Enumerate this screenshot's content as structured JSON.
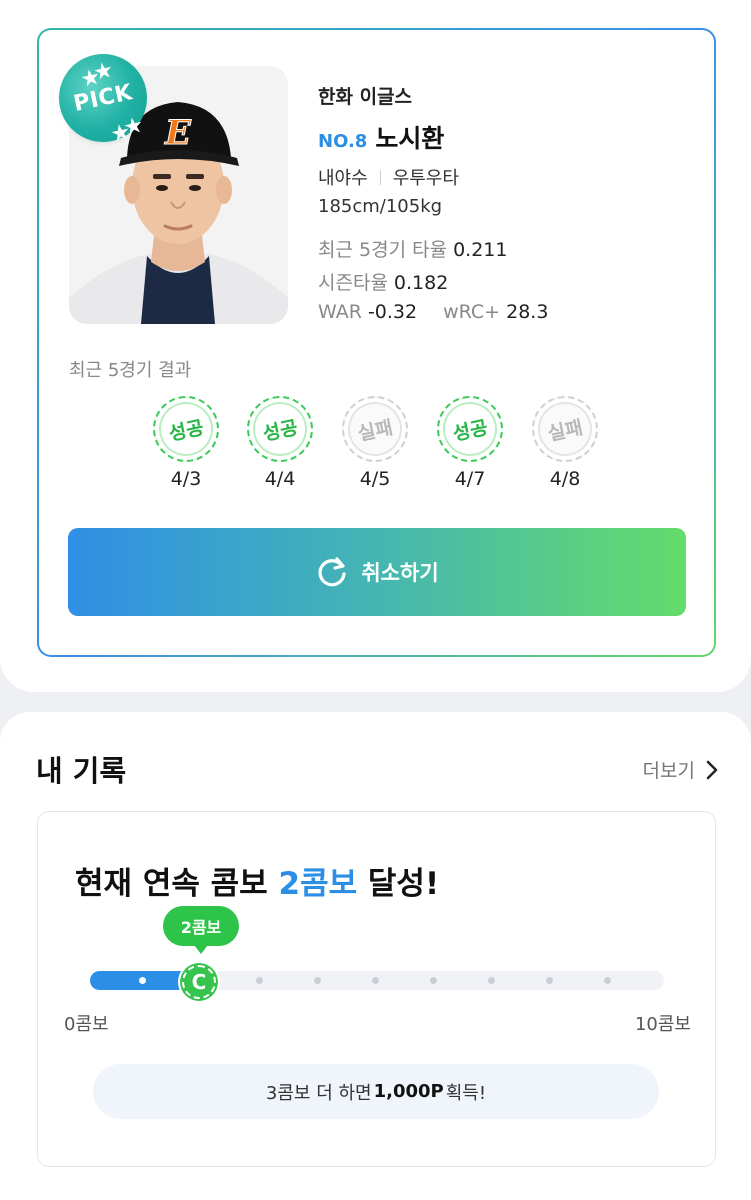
{
  "player_card": {
    "pick_badge": "PICK",
    "team": "한화 이글스",
    "number": "NO.8",
    "name": "노시환",
    "position": "내야수",
    "bats_throws": "우투우타",
    "physical": "185cm/105kg",
    "stats": {
      "recent5_label": "최근 5경기 타율",
      "recent5_value": "0.211",
      "season_label": "시즌타율",
      "season_value": "0.182",
      "war_label": "WAR",
      "war_value": "-0.32",
      "wrc_label": "wRC+",
      "wrc_value": "28.3"
    },
    "recent_results_title": "최근 5경기 결과",
    "recent_results": [
      {
        "result": "성공",
        "status": "success",
        "date": "4/3"
      },
      {
        "result": "성공",
        "status": "success",
        "date": "4/4"
      },
      {
        "result": "실패",
        "status": "fail",
        "date": "4/5"
      },
      {
        "result": "성공",
        "status": "success",
        "date": "4/7"
      },
      {
        "result": "실패",
        "status": "fail",
        "date": "4/8"
      }
    ],
    "cancel_button": "취소하기"
  },
  "my_record": {
    "title": "내 기록",
    "more_link": "더보기",
    "combo_title_prefix": "현재 연속 콤보 ",
    "combo_title_highlight": "2콤보",
    "combo_title_suffix": " 달성!",
    "current_combo_bubble": "2콤보",
    "marker_letter": "C",
    "progress": {
      "current": 2,
      "max": 10
    },
    "range_min": "0콤보",
    "range_max": "10콤보",
    "reward_prefix": "3콤보 더 하면 ",
    "reward_points": "1,000P",
    "reward_suffix": " 획득!"
  },
  "colors": {
    "accent_blue": "#2b8fe6",
    "success_green": "#36c44f",
    "fail_gray": "#b8b8b8"
  }
}
